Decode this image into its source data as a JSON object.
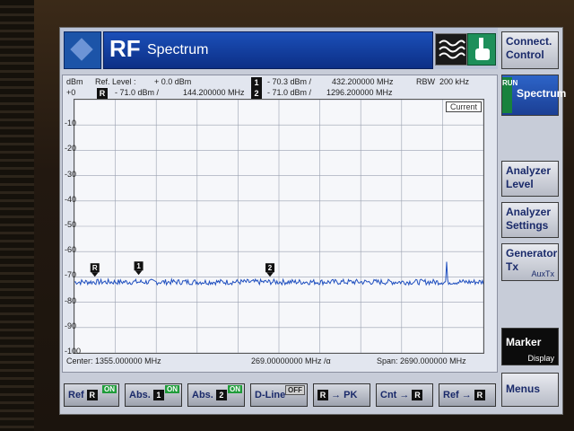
{
  "title": {
    "rf": "RF",
    "name": "Spectrum"
  },
  "softkeys": {
    "connect_control": "Connect. Control",
    "run_tag": "RUN",
    "spectrum": "Spectrum",
    "analyzer_level": "Analyzer Level",
    "analyzer_settings": "Analyzer Settings",
    "generator_tx": "Generator Tx",
    "generator_sub": "AuxTx",
    "marker": "Marker",
    "marker_sub": "Display",
    "menus": "Menus"
  },
  "header": {
    "y_unit": "dBm",
    "ref_level_label": "Ref. Level :",
    "ref_level_value": "+ 0.0  dBm",
    "ref_top": "+0",
    "ref_marker": "R",
    "ref_marker_level": "- 71.0  dBm /",
    "ref_marker_freq": "144.200000  MHz",
    "m1_label": "1",
    "m1_level": "- 70.3  dBm /",
    "m1_freq": "432.200000  MHz",
    "m2_label": "2",
    "m2_level": "- 71.0  dBm /",
    "m2_freq": "1296.200000  MHz",
    "rbw_label": "RBW",
    "rbw_value": "200  kHz",
    "current_label": "Current"
  },
  "footer": {
    "center": "Center:    1355.000000  MHz",
    "division": "269.00000000 MHz  /α",
    "span": "Span:   2690.000000  MHz"
  },
  "bottom_keys": [
    {
      "label": "Ref",
      "marker": "R",
      "state": "ON"
    },
    {
      "label": "Abs.",
      "marker": "1",
      "state": "ON"
    },
    {
      "label": "Abs.",
      "marker": "2",
      "state": "ON"
    },
    {
      "label": "D-Line",
      "state": "OFF"
    },
    {
      "label": "→  PK",
      "marker": "R"
    },
    {
      "label": "Cnt  →",
      "marker": "R"
    },
    {
      "label": "Ref  →",
      "marker": "R"
    }
  ],
  "chart_data": {
    "type": "line",
    "xlabel": "",
    "ylabel": "dBm",
    "xlim": [
      10,
      2700
    ],
    "ylim": [
      -100,
      0
    ],
    "y_ticks": [
      "+0",
      "-10",
      "-20",
      "-30",
      "-40",
      "-50",
      "-60",
      "-70",
      "-80",
      "-90",
      "-100"
    ],
    "grid": true,
    "noise_floor_dbm": -72,
    "spike": {
      "x_mhz": 2460,
      "y_dbm": -64
    },
    "markers": [
      {
        "name": "R",
        "x_mhz": 144.2,
        "y_dbm": -71.0
      },
      {
        "name": "1",
        "x_mhz": 432.2,
        "y_dbm": -70.3
      },
      {
        "name": "2",
        "x_mhz": 1296.2,
        "y_dbm": -71.0
      }
    ],
    "colors": {
      "trace": "#1f4fbf",
      "grid": "#9aa0b0"
    }
  }
}
